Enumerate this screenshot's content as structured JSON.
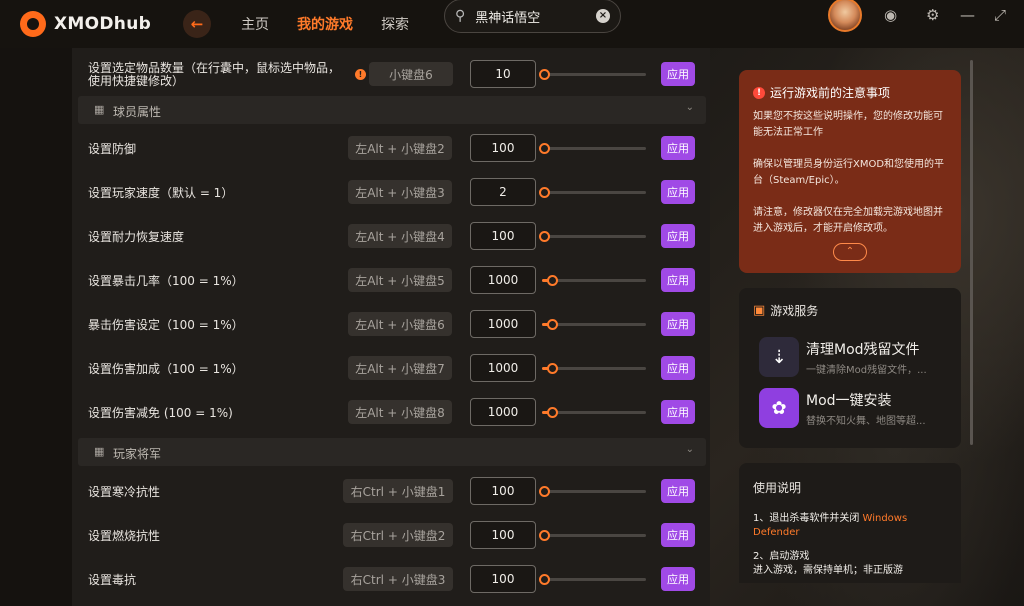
{
  "app": {
    "name": "XMODhub"
  },
  "nav": {
    "home": "主页",
    "my_games": "我的游戏",
    "explore": "探索"
  },
  "search": {
    "value": "黑神话悟空"
  },
  "rows_top": [
    {
      "label": "设置选定物品数量（在行囊中，鼠标选中物品，使用快捷键修改）",
      "hotkey": "小键盘6",
      "value": "10",
      "slider_pct": 0,
      "apply": "应用"
    }
  ],
  "section_player": {
    "title": "球员属性"
  },
  "rows_player": [
    {
      "label": "设置防御",
      "hotkey": "左Alt + 小键盘2",
      "value": "100",
      "slider_pct": 0,
      "apply": "应用"
    },
    {
      "label": "设置玩家速度（默认 = 1）",
      "hotkey": "左Alt + 小键盘3",
      "value": "2",
      "slider_pct": 0,
      "apply": "应用"
    },
    {
      "label": "设置耐力恢复速度",
      "hotkey": "左Alt + 小键盘4",
      "value": "100",
      "slider_pct": 0,
      "apply": "应用"
    },
    {
      "label": "设置暴击几率（100 = 1%）",
      "hotkey": "左Alt + 小键盘5",
      "value": "1000",
      "slider_pct": 8,
      "apply": "应用"
    },
    {
      "label": "暴击伤害设定（100 = 1%）",
      "hotkey": "左Alt + 小键盘6",
      "value": "1000",
      "slider_pct": 8,
      "apply": "应用"
    },
    {
      "label": "设置伤害加成（100 = 1%）",
      "hotkey": "左Alt + 小键盘7",
      "value": "1000",
      "slider_pct": 8,
      "apply": "应用"
    },
    {
      "label": "设置伤害减免 (100 = 1%)",
      "hotkey": "左Alt + 小键盘8",
      "value": "1000",
      "slider_pct": 8,
      "apply": "应用"
    }
  ],
  "section_general": {
    "title": "玩家将军"
  },
  "rows_general": [
    {
      "label": "设置寒冷抗性",
      "hotkey": "右Ctrl + 小键盘1",
      "value": "100",
      "slider_pct": 0,
      "apply": "应用"
    },
    {
      "label": "设置燃烧抗性",
      "hotkey": "右Ctrl + 小键盘2",
      "value": "100",
      "slider_pct": 0,
      "apply": "应用"
    },
    {
      "label": "设置毒抗",
      "hotkey": "右Ctrl + 小键盘3",
      "value": "100",
      "slider_pct": 0,
      "apply": "应用"
    }
  ],
  "notice": {
    "title": "运行游戏前的注意事项",
    "p1": "如果您不按这些说明操作，您的修改功能可能无法正常工作",
    "p2": "确保以管理员身份运行XMOD和您使用的平台（Steam/Epic）。",
    "p3": "请注意，修改器仅在完全加载完游戏地图并进入游戏后，才能开启修改项。"
  },
  "services": {
    "title": "游戏服务",
    "items": [
      {
        "title": "清理Mod残留文件",
        "desc": "一键清除Mod残留文件，..."
      },
      {
        "title": "Mod一键安装",
        "desc": "替换不知火舞、地图等超..."
      }
    ]
  },
  "usage": {
    "title": "使用说明",
    "step1_prefix": "1、退出杀毒软件并关闭 ",
    "step1_highlight": "Windows Defender",
    "step2_title": "2、启动游戏",
    "step2_text": "进入游戏，需保持单机；非正版游"
  },
  "colors": {
    "accent": "#ff7a2a",
    "apply": "#a04ae6",
    "notice_bg": "#7a2c17"
  }
}
